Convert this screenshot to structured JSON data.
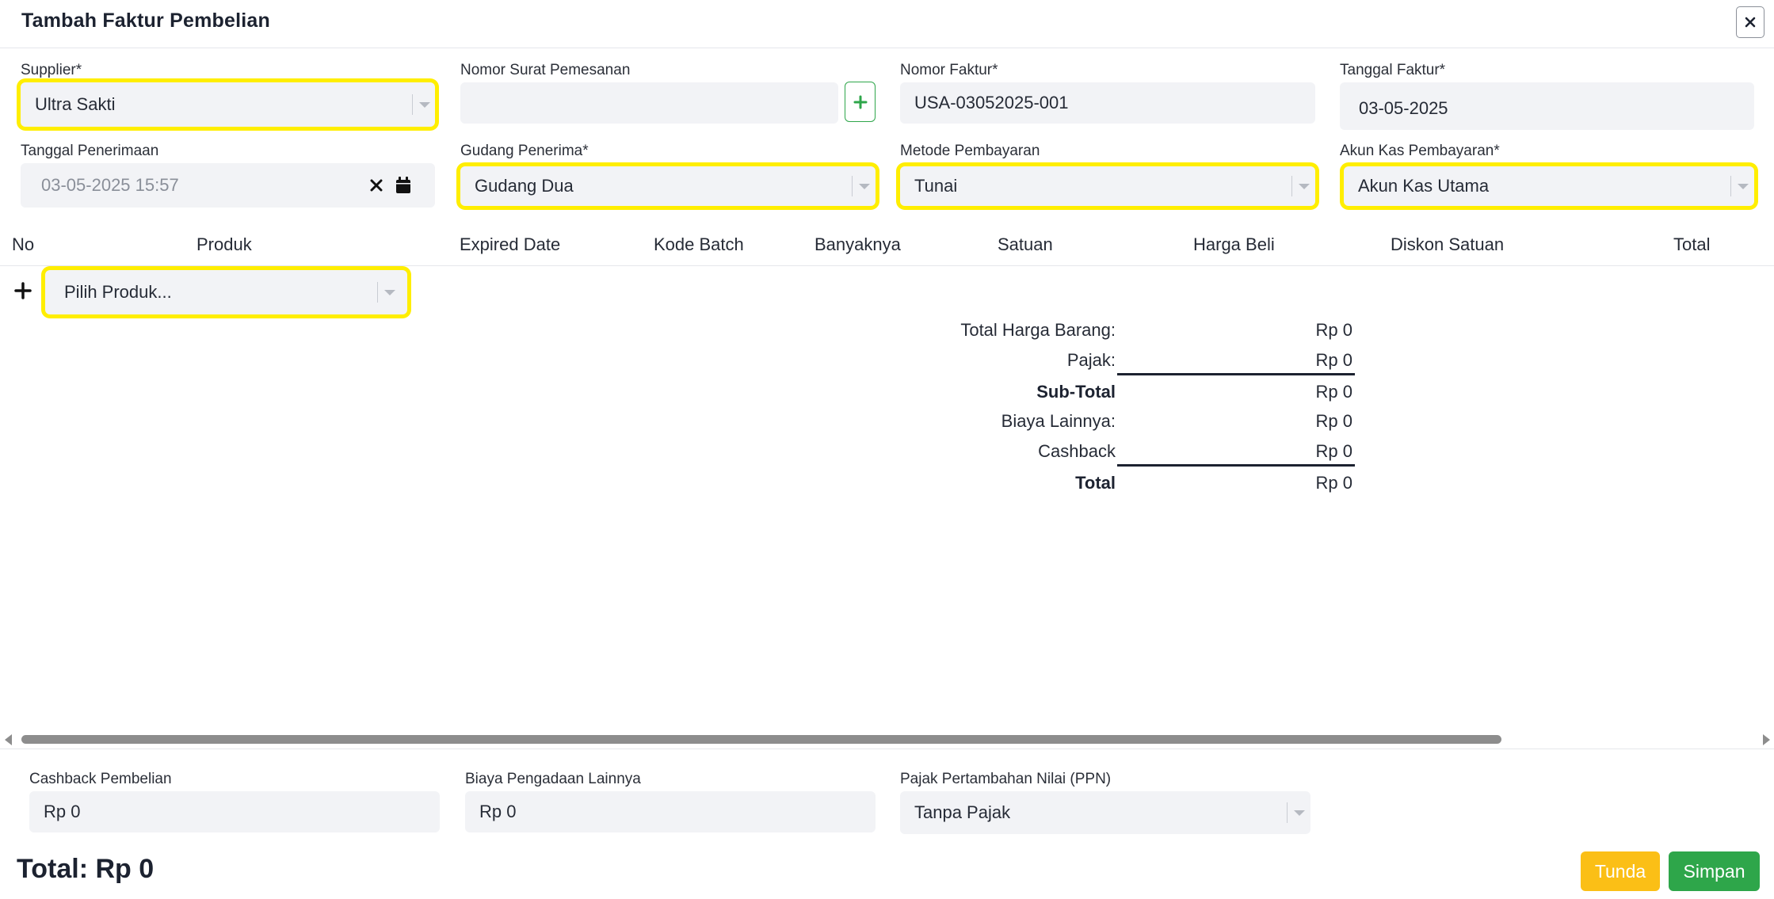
{
  "modal": {
    "title": "Tambah Faktur Pembelian",
    "close_icon": "close-icon"
  },
  "form": {
    "supplier": {
      "label": "Supplier*",
      "value": "Ultra Sakti"
    },
    "nomor_surat_pemesanan": {
      "label": "Nomor Surat Pemesanan",
      "value": ""
    },
    "nomor_faktur": {
      "label": "Nomor Faktur*",
      "value": "USA-03052025-001"
    },
    "tanggal_faktur": {
      "label": "Tanggal Faktur*",
      "value": "03-05-2025"
    },
    "tanggal_penerimaan": {
      "label": "Tanggal Penerimaan",
      "value": "03-05-2025 15:57"
    },
    "gudang_penerima": {
      "label": "Gudang Penerima*",
      "value": "Gudang Dua"
    },
    "metode_pembayaran": {
      "label": "Metode Pembayaran",
      "value": "Tunai"
    },
    "akun_kas_pembayaran": {
      "label": "Akun Kas Pembayaran*",
      "value": "Akun Kas Utama"
    }
  },
  "table": {
    "columns": [
      "No",
      "Produk",
      "Expired Date",
      "Kode Batch",
      "Banyaknya",
      "Satuan",
      "Harga Beli",
      "Diskon Satuan",
      "Total"
    ],
    "product_select_placeholder": "Pilih Produk..."
  },
  "summary": {
    "total_harga_barang": {
      "label": "Total Harga Barang:",
      "value": "Rp 0"
    },
    "pajak": {
      "label": "Pajak:",
      "value": "Rp 0"
    },
    "sub_total": {
      "label": "Sub-Total",
      "value": "Rp 0"
    },
    "biaya_lainnya": {
      "label": "Biaya Lainnya:",
      "value": "Rp 0"
    },
    "cashback": {
      "label": "Cashback",
      "value": "Rp 0"
    },
    "total": {
      "label": "Total",
      "value": "Rp 0"
    }
  },
  "footer": {
    "cashback_pembelian": {
      "label": "Cashback Pembelian",
      "value": "Rp 0"
    },
    "biaya_pengadaan_lainnya": {
      "label": "Biaya Pengadaan Lainnya",
      "value": "Rp 0"
    },
    "ppn": {
      "label": "Pajak Pertambahan Nilai (PPN)",
      "value": "Tanpa Pajak"
    },
    "grand_total": "Total: Rp 0",
    "tunda_label": "Tunda",
    "simpan_label": "Simpan"
  },
  "colors": {
    "highlight": "#ffee00",
    "primary_green": "#2ea64a",
    "warning_yellow": "#fbbf16",
    "input_bg": "#f2f3f6"
  }
}
